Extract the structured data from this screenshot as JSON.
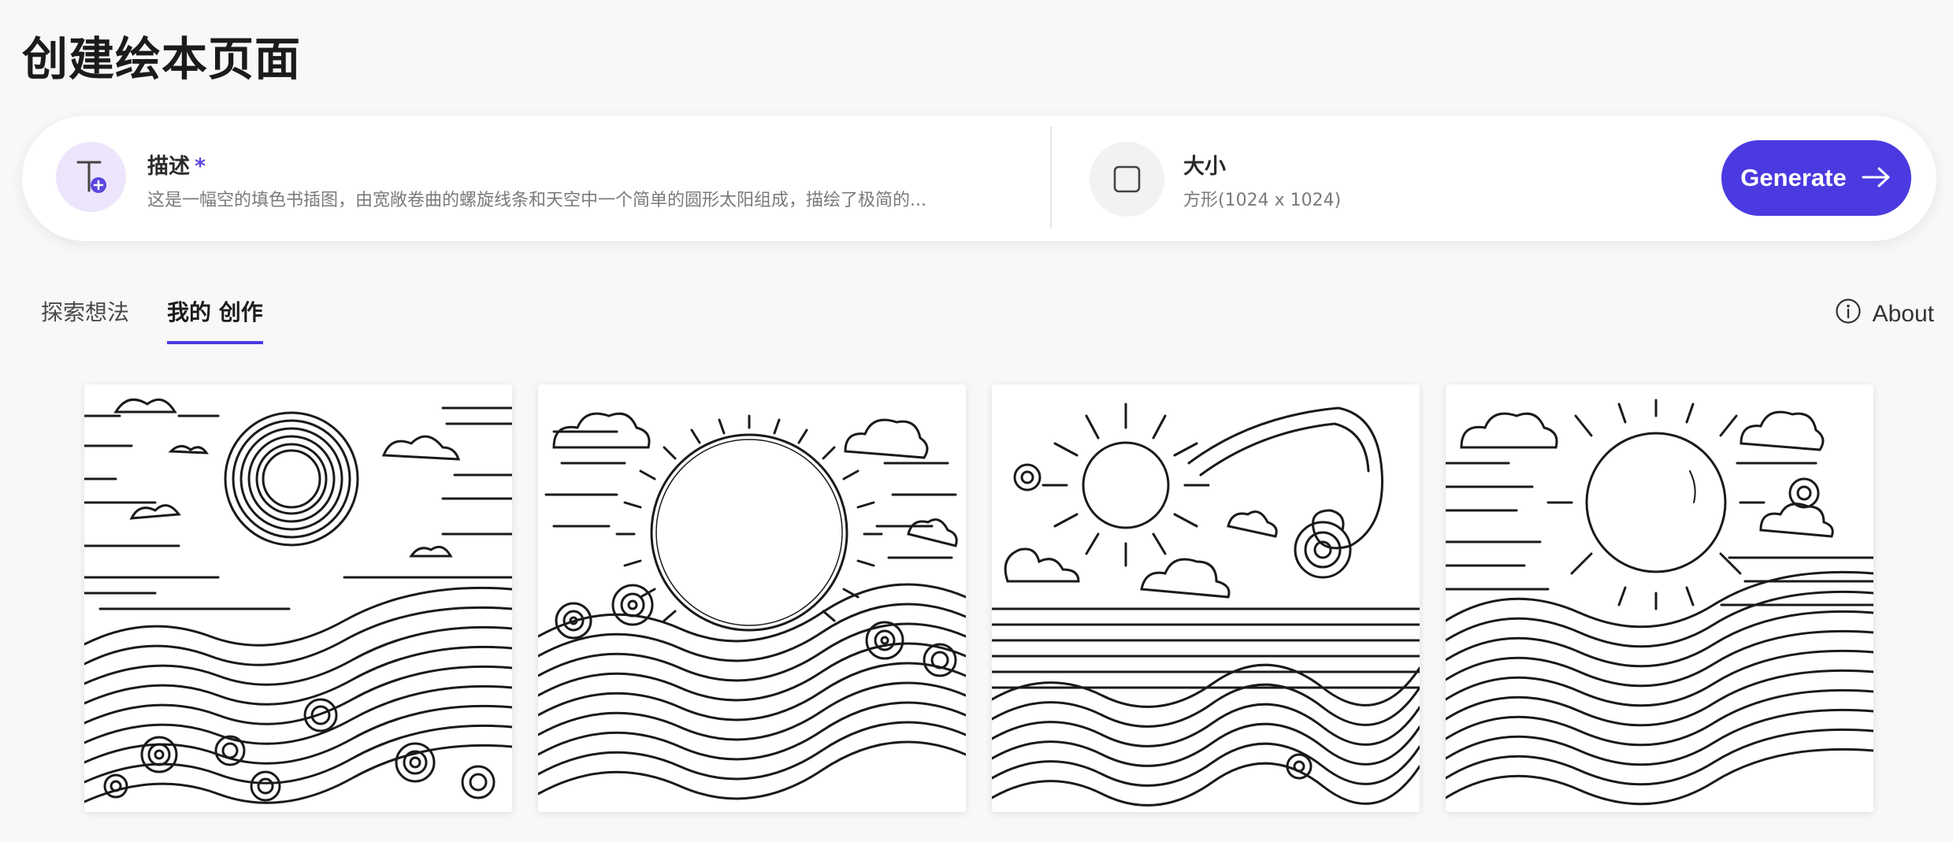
{
  "page_title": "创建绘本页面",
  "prompt": {
    "description_label": "描述",
    "required_mark": "*",
    "description_text": "这是一幅空的填色书插图，由宽敞卷曲的螺旋线条和天空中一个简单的圆形太阳组成，描绘了极简的...",
    "size_label": "大小",
    "size_value": "方形(1024 x 1024)",
    "generate_label": "Generate"
  },
  "tabs": [
    {
      "label": "探索想法",
      "active": false
    },
    {
      "label": "我的 创作",
      "active": true
    }
  ],
  "about_label": "About",
  "colors": {
    "accent": "#4b3ae0",
    "icon_bg": "#ece5fb",
    "background": "#f8f8f9"
  },
  "icons": {
    "description": "text-add-icon",
    "size": "square-icon",
    "generate": "arrow-right-icon",
    "about": "info-icon"
  },
  "gallery_count": 4
}
